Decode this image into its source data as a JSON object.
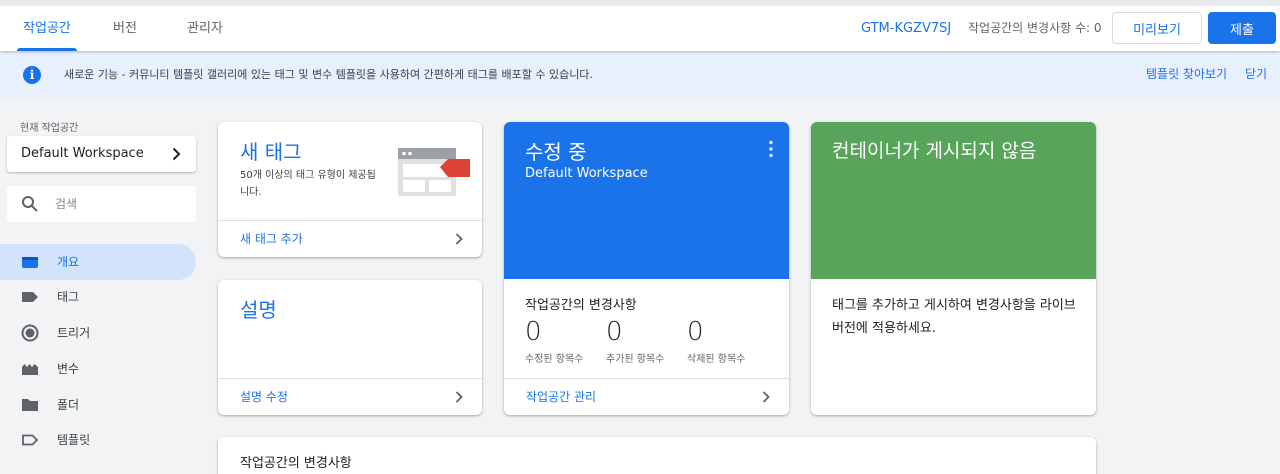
{
  "nav": {
    "tabs": [
      {
        "label": "작업공간",
        "active": true
      },
      {
        "label": "버전",
        "active": false
      },
      {
        "label": "관리자",
        "active": false
      }
    ],
    "container_id": "GTM-KGZV7SJ",
    "workspace_changes": "작업공간의 변경사항 수: 0",
    "preview_label": "미리보기",
    "submit_label": "제출"
  },
  "banner": {
    "icon": "info-icon",
    "text": "새로운 기능 - 커뮤니티 템플릿 갤러리에 있는 태그 및 변수 템플릿을 사용하여 간편하게 태그를 배포할 수 있습니다.",
    "explore_label": "템플릿 찾아보기",
    "close_label": "닫기"
  },
  "sidebar": {
    "workspace_caption": "현재 작업공간",
    "workspace_name": "Default Workspace",
    "search_placeholder": "검색",
    "items": [
      {
        "label": "개요",
        "icon": "overview-icon",
        "active": true
      },
      {
        "label": "태그",
        "icon": "tag-icon",
        "active": false
      },
      {
        "label": "트리거",
        "icon": "trigger-icon",
        "active": false
      },
      {
        "label": "변수",
        "icon": "variable-icon",
        "active": false
      },
      {
        "label": "폴더",
        "icon": "folder-icon",
        "active": false
      },
      {
        "label": "템플릿",
        "icon": "template-icon",
        "active": false
      }
    ]
  },
  "cards": {
    "new_tag": {
      "title": "새 태그",
      "description": "50개 이상의 태그 유형이 제공됩니다.",
      "link": "새 태그 추가"
    },
    "description": {
      "title": "설명",
      "link": "설명 수정"
    },
    "editing": {
      "title": "수정 중",
      "subtitle": "Default Workspace",
      "changes_heading": "작업공간의 변경사항",
      "stats": [
        {
          "value": "0",
          "label": "수정된 항목수"
        },
        {
          "value": "0",
          "label": "추가된 항목수"
        },
        {
          "value": "0",
          "label": "삭제된 항목수"
        }
      ],
      "link": "작업공간 관리"
    },
    "publish": {
      "title": "컨테이너가 게시되지 않음",
      "body": "태그를 추가하고 게시하여 변경사항을 라이브 버전에 적용하세요."
    },
    "bottom": {
      "title": "작업공간의 변경사항"
    }
  },
  "colors": {
    "accent": "#1a73e8",
    "editing_card": "#1a73e8",
    "publish_card": "#57a45a",
    "banner_bg": "#e8f0fe",
    "active_nav_bg": "#d2e3fc"
  }
}
